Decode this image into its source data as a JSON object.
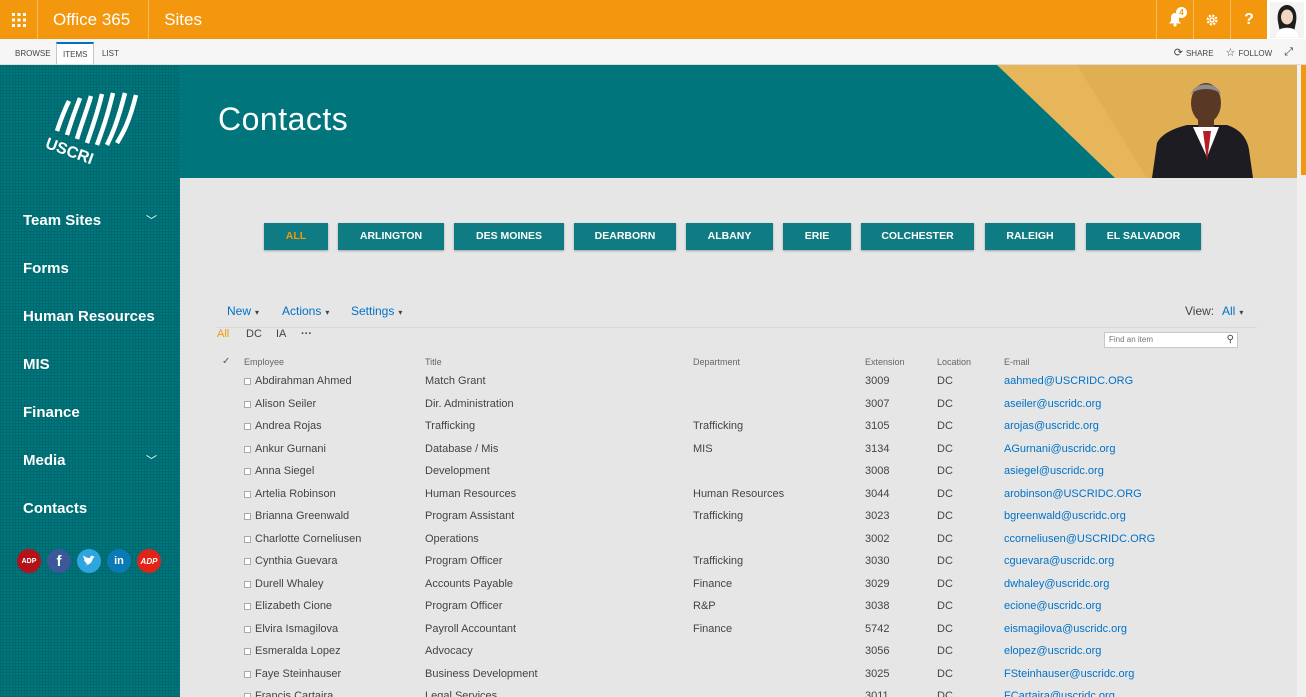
{
  "suite": {
    "brand": "Office 365",
    "site": "Sites",
    "notification_count": "4",
    "settings_icon": "gear-icon",
    "help_label": "?"
  },
  "ribbon": {
    "tabs": [
      "BROWSE",
      "ITEMS",
      "LIST"
    ],
    "share": "SHARE",
    "follow": "FOLLOW"
  },
  "sidebar": {
    "logo_text": "USCRI",
    "items": [
      {
        "label": "Team Sites",
        "expandable": true
      },
      {
        "label": "Forms",
        "expandable": false
      },
      {
        "label": "Human Resources",
        "expandable": false
      },
      {
        "label": "MIS",
        "expandable": false
      },
      {
        "label": "Finance",
        "expandable": false
      },
      {
        "label": "Media",
        "expandable": true
      },
      {
        "label": "Contacts",
        "expandable": false
      }
    ],
    "socials": [
      {
        "name": "adp-alt-icon",
        "label": "ADP",
        "color": "#b3121a"
      },
      {
        "name": "facebook-icon",
        "label": "f",
        "color": "#3b5998"
      },
      {
        "name": "twitter-icon",
        "label": "t",
        "color": "#2fa5e0"
      },
      {
        "name": "linkedin-icon",
        "label": "in",
        "color": "#0a79b4"
      },
      {
        "name": "adp-icon",
        "label": "ADP",
        "color": "#e2231a"
      }
    ]
  },
  "banner": {
    "title": "Contacts"
  },
  "locations": [
    "ALL",
    "ARLINGTON",
    "DES MOINES",
    "DEARBORN",
    "ALBANY",
    "ERIE",
    "COLCHESTER",
    "RALEIGH",
    "EL SALVADOR"
  ],
  "commands": {
    "new": "New",
    "actions": "Actions",
    "settings": "Settings",
    "view_label": "View:",
    "view_value": "All"
  },
  "view_tabs": [
    "All",
    "DC",
    "IA",
    "···"
  ],
  "search": {
    "placeholder": "Find an item"
  },
  "table": {
    "columns": [
      "Employee",
      "Title",
      "Department",
      "Extension",
      "Location",
      "E-mail"
    ],
    "rows": [
      [
        "Abdirahman Ahmed",
        "Match Grant",
        "",
        "3009",
        "DC",
        "aahmed@USCRIDC.ORG"
      ],
      [
        "Alison Seiler",
        "Dir. Administration",
        "",
        "3007",
        "DC",
        "aseiler@uscridc.org"
      ],
      [
        "Andrea Rojas",
        "Trafficking",
        "Trafficking",
        "3105",
        "DC",
        "arojas@uscridc.org"
      ],
      [
        "Ankur Gurnani",
        "Database / Mis",
        "MIS",
        "3134",
        "DC",
        "AGurnani@uscridc.org"
      ],
      [
        "Anna Siegel",
        "Development",
        "",
        "3008",
        "DC",
        "asiegel@uscridc.org"
      ],
      [
        "Artelia Robinson",
        "Human Resources",
        "Human Resources",
        "3044",
        "DC",
        "arobinson@USCRIDC.ORG"
      ],
      [
        "Brianna Greenwald",
        "Program Assistant",
        "Trafficking",
        "3023",
        "DC",
        "bgreenwald@uscridc.org"
      ],
      [
        "Charlotte Corneliusen",
        "Operations",
        "",
        "3002",
        "DC",
        "ccorneliusen@USCRIDC.ORG"
      ],
      [
        "Cynthia Guevara",
        "Program Officer",
        "Trafficking",
        "3030",
        "DC",
        "cguevara@uscridc.org"
      ],
      [
        "Durell Whaley",
        "Accounts Payable",
        "Finance",
        "3029",
        "DC",
        "dwhaley@uscridc.org"
      ],
      [
        "Elizabeth Cione",
        "Program Officer",
        "R&P",
        "3038",
        "DC",
        "ecione@uscridc.org"
      ],
      [
        "Elvira Ismagilova",
        "Payroll Accountant",
        "Finance",
        "5742",
        "DC",
        "eismagilova@uscridc.org"
      ],
      [
        "Esmeralda Lopez",
        "Advocacy",
        "",
        "3056",
        "DC",
        "elopez@uscridc.org"
      ],
      [
        "Faye Steinhauser",
        "Business Development",
        "",
        "3025",
        "DC",
        "FSteinhauser@uscridc.org"
      ],
      [
        "Francis Cartaira",
        "Legal Services",
        "",
        "3011",
        "DC",
        "FCartaira@uscridc.org"
      ]
    ]
  },
  "colors": {
    "accent": "#f3980e",
    "teal": "#00757c",
    "link": "#0072c6"
  }
}
